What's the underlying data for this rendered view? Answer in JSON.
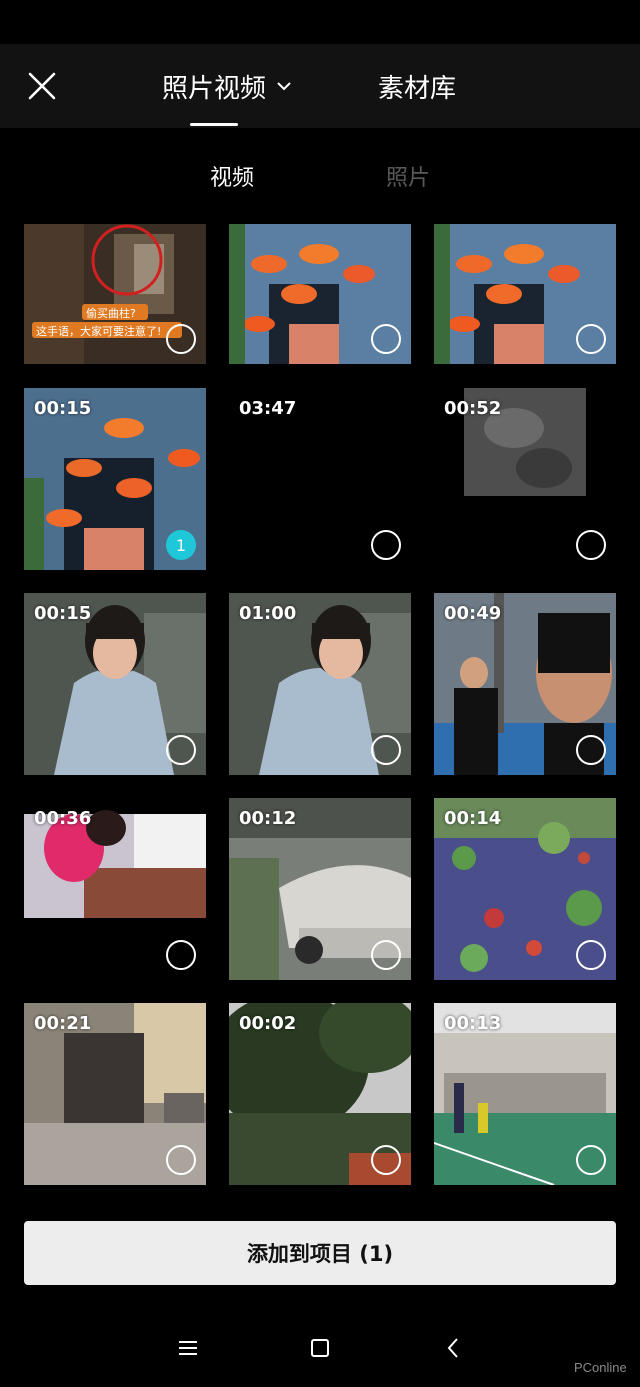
{
  "header": {
    "close_icon": "close-icon",
    "tab_photos_videos": "照片视频",
    "tab_library": "素材库"
  },
  "subtabs": {
    "video": "视频",
    "photo": "照片"
  },
  "thumb_captions": {
    "question": "偷买曲柱?",
    "warning": "这手语，大家可要注意了!"
  },
  "grid": {
    "items": [
      {
        "duration": "",
        "selected": false
      },
      {
        "duration": "",
        "selected": false
      },
      {
        "duration": "",
        "selected": false
      },
      {
        "duration": "00:15",
        "selected": true,
        "order": "1"
      },
      {
        "duration": "03:47",
        "selected": false
      },
      {
        "duration": "00:52",
        "selected": false
      },
      {
        "duration": "00:15",
        "selected": false
      },
      {
        "duration": "01:00",
        "selected": false
      },
      {
        "duration": "00:49",
        "selected": false
      },
      {
        "duration": "00:36",
        "selected": false
      },
      {
        "duration": "00:12",
        "selected": false
      },
      {
        "duration": "00:14",
        "selected": false
      },
      {
        "duration": "00:21",
        "selected": false
      },
      {
        "duration": "00:02",
        "selected": false
      },
      {
        "duration": "00:13",
        "selected": false
      }
    ]
  },
  "footer": {
    "add_button": "添加到项目 (1)"
  },
  "watermark": "PConline",
  "colors": {
    "accent": "#1fc8d9",
    "background": "#000000",
    "topbar": "#121212",
    "inactive_tab": "#5a5a5a"
  }
}
